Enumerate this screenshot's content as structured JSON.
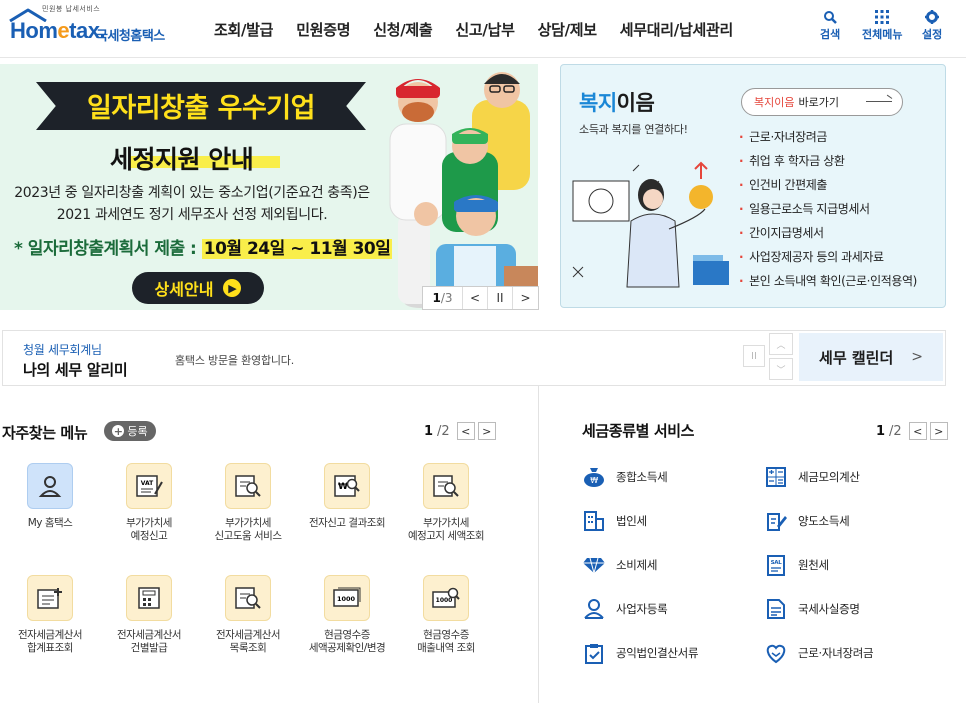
{
  "header": {
    "logo_tiny": "민원봉 납세서비스",
    "logo_brand_pre": "Hom",
    "logo_brand_e": "e",
    "logo_brand_post": "tax.",
    "logo_kname": "국세청홈택스",
    "nav": [
      "조회/발급",
      "민원증명",
      "신청/제출",
      "신고/납부",
      "상담/제보",
      "세무대리/납세관리"
    ],
    "util": {
      "search": "검색",
      "all_menu": "전체메뉴",
      "settings": "설정"
    },
    "brand_color": "#1a5fb4"
  },
  "banner": {
    "ribbon": "일자리창출 우수기업",
    "subtitle": "세정지원 안내",
    "desc1": "2023년 중 일자리창출 계획이 있는 중소기업(기준요건 충족)은",
    "desc2": "2021 과세연도 정기 세무조사 선정 제외됩니다.",
    "extra_pre": "* 일자리창출계획서 제출 : ",
    "extra_hl": "10월 24일 ~ 11월 30일",
    "button": "상세안내",
    "pager": {
      "current": "1",
      "total": "/3",
      "prev": "<",
      "pause": "II",
      "next": ">"
    }
  },
  "welfare": {
    "title_a": "복지",
    "title_b": "이음",
    "subtitle": "소득과 복지를 연결하다!",
    "button_hl": "복지이음",
    "button_rest": "바로가기",
    "items": [
      "근로·자녀장려금",
      "취업 후 학자금 상환",
      "인건비 간편제출",
      "일용근로소득 지급명세서",
      "간이지급명세서",
      "사업장제공자 등의 과세자료",
      "본인 소득내역 확인(근로·인적용역)"
    ]
  },
  "alert": {
    "small": "청월 세무회계님",
    "big": "나의 세무 알리미",
    "message": "홈택스 방문을 환영합니다.",
    "calendar": "세무 캘린더",
    "calendar_chev": ">",
    "pause": "II",
    "up": "︿",
    "down": "﹀"
  },
  "frequent": {
    "title": "자주찾는 메뉴",
    "register": "등록",
    "register_plus": "+",
    "page_current": "1",
    "page_total": "/2",
    "prev": "<",
    "next": ">",
    "tiles": [
      {
        "label": "My 홈택스"
      },
      {
        "label": "부가가치세\n예정신고"
      },
      {
        "label": "부가가치세\n신고도움 서비스"
      },
      {
        "label": "전자신고 결과조회"
      },
      {
        "label": "부가가치세\n예정고지 세액조회"
      },
      {
        "label": "전자세금계산서\n합계표조회"
      },
      {
        "label": "전자세금계산서\n건별발급"
      },
      {
        "label": "전자세금계산서\n목록조회"
      },
      {
        "label": "현금영수증\n세액공제확인/변경"
      },
      {
        "label": "현금영수증\n매출내역 조회"
      }
    ],
    "tile_icon_texts": {
      "vat": "VAT",
      "won": "₩",
      "thousand": "1000"
    }
  },
  "tax_services": {
    "title": "세금종류별 서비스",
    "page_current": "1",
    "page_total": "/2",
    "prev": "<",
    "next": ">",
    "items": [
      {
        "label": "종합소득세"
      },
      {
        "label": "세금모의계산"
      },
      {
        "label": "법인세"
      },
      {
        "label": "양도소득세"
      },
      {
        "label": "소비제세"
      },
      {
        "label": "원천세"
      },
      {
        "label": "사업자등록"
      },
      {
        "label": "국세사실증명"
      },
      {
        "label": "공익법인결산서류"
      },
      {
        "label": "근로·자녀장려금"
      }
    ],
    "icon_texts": {
      "sal": "SAL"
    }
  }
}
